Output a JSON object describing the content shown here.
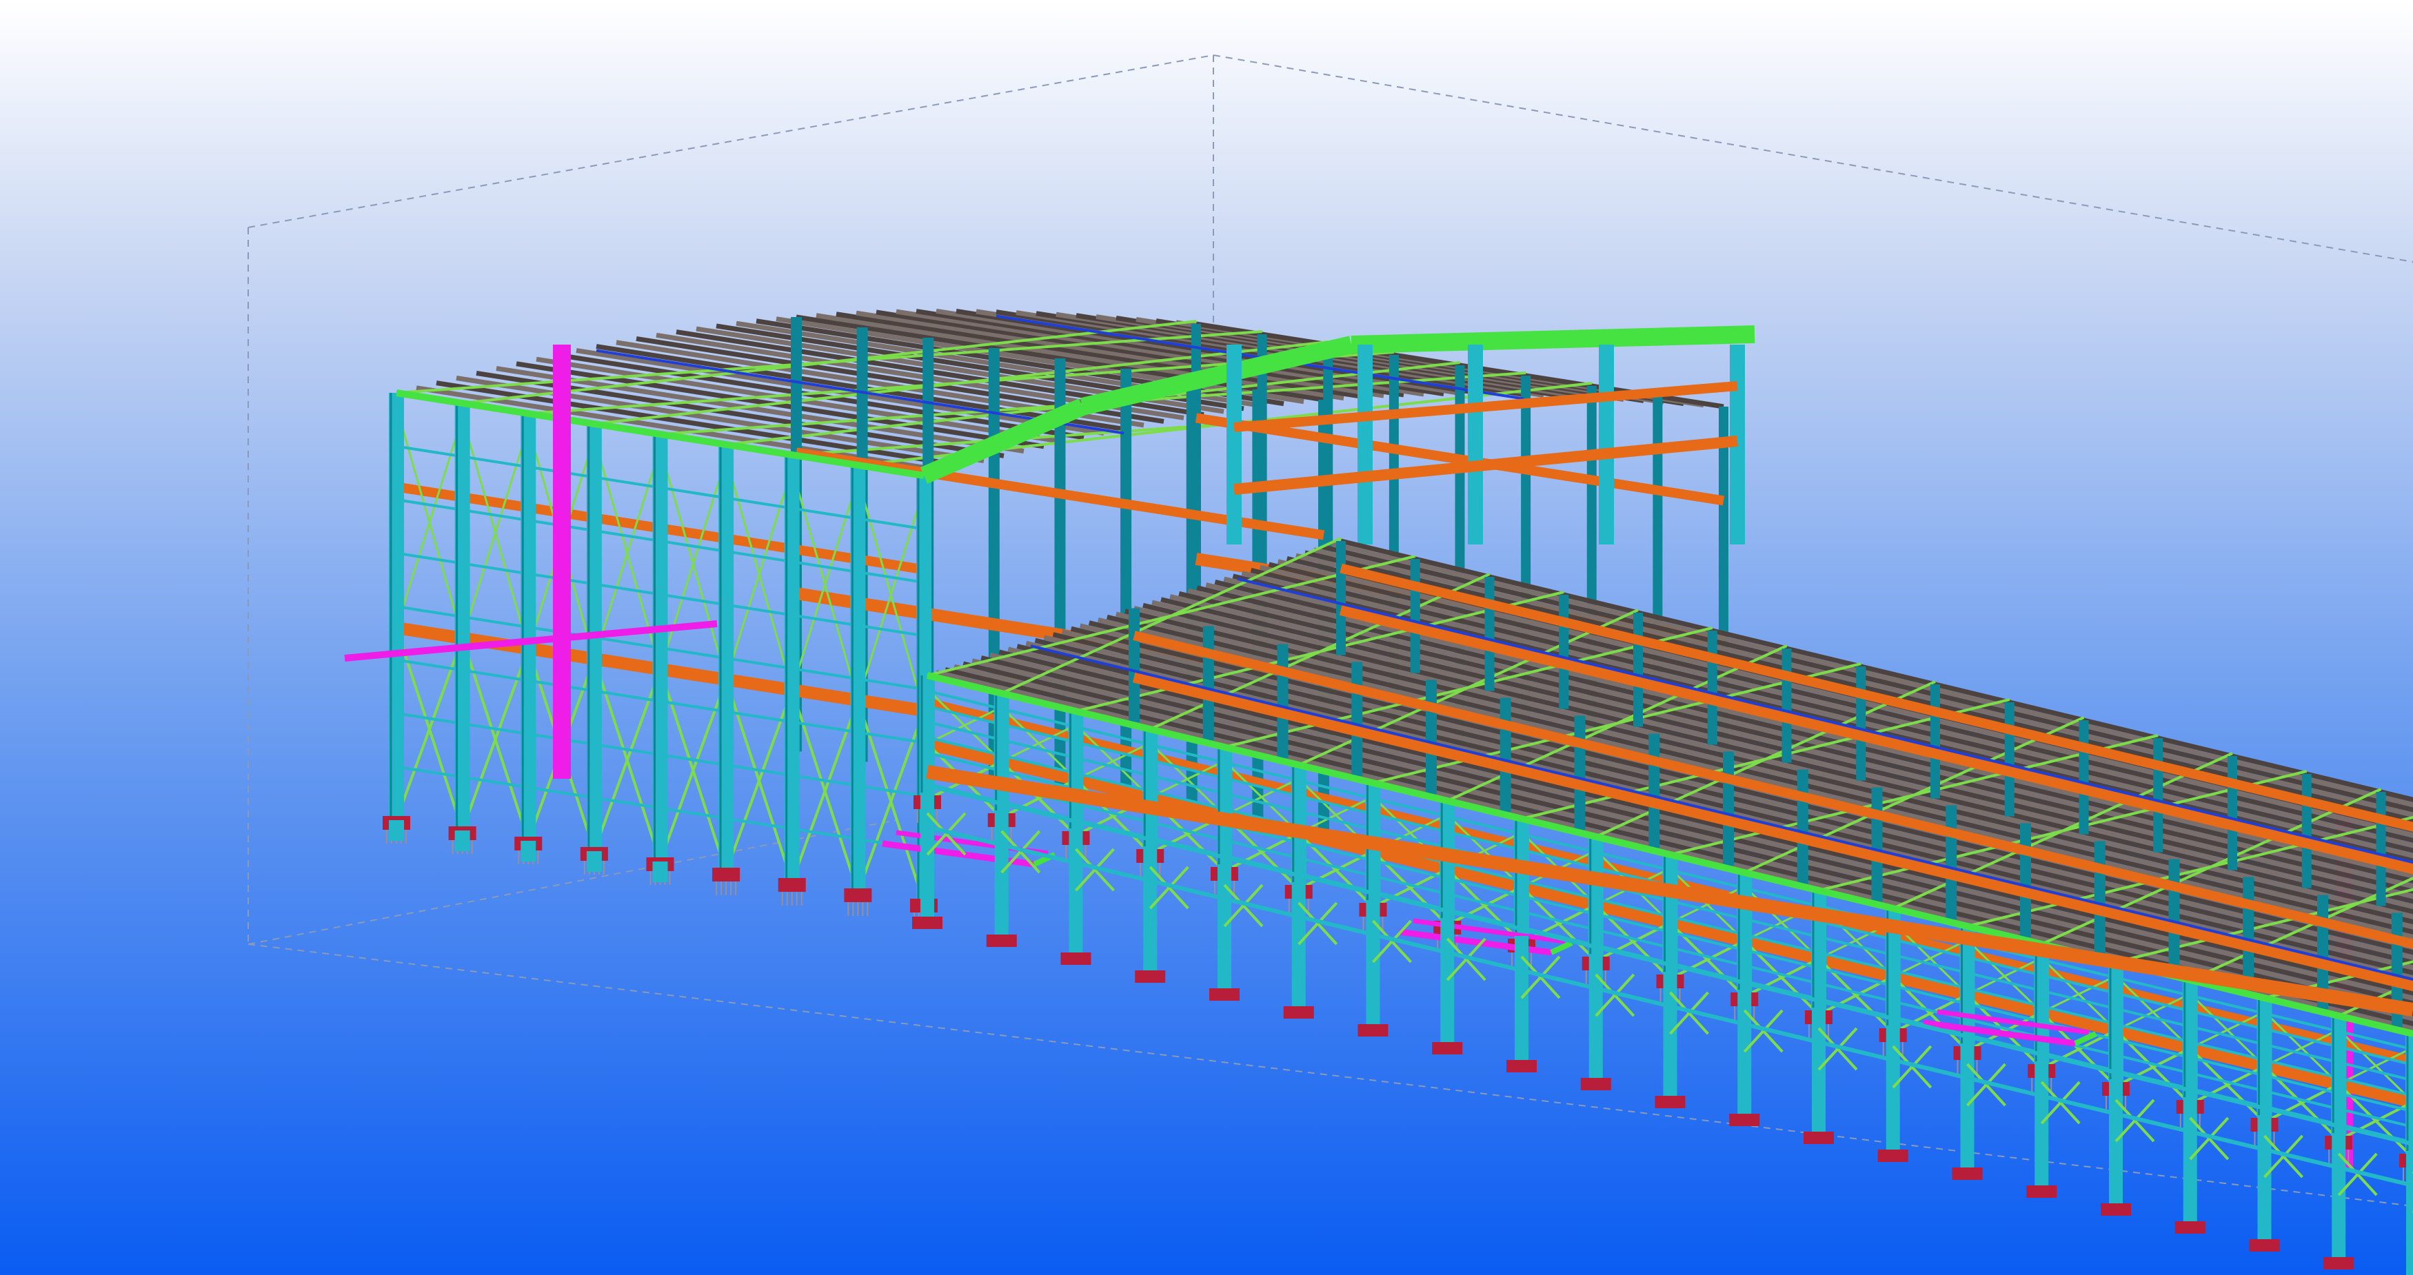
{
  "viewport": {
    "background_top": "#ffffff",
    "background_bottom": "#0a5cf2",
    "content": "3d-steel-structure-model"
  },
  "colors": {
    "column": "#22b8c8",
    "column_dark": "#0e8596",
    "bracing": "#7ddc4a",
    "purlin": "#7a6f6a",
    "purlin_dark": "#4c4340",
    "girt": "#e66a18",
    "highlight": "#ee1ee8",
    "rafter": "#46e242",
    "edge_blue": "#1f3fd8",
    "base_plate": "#b81d3a",
    "work_area_box": "#8a9ab8"
  }
}
